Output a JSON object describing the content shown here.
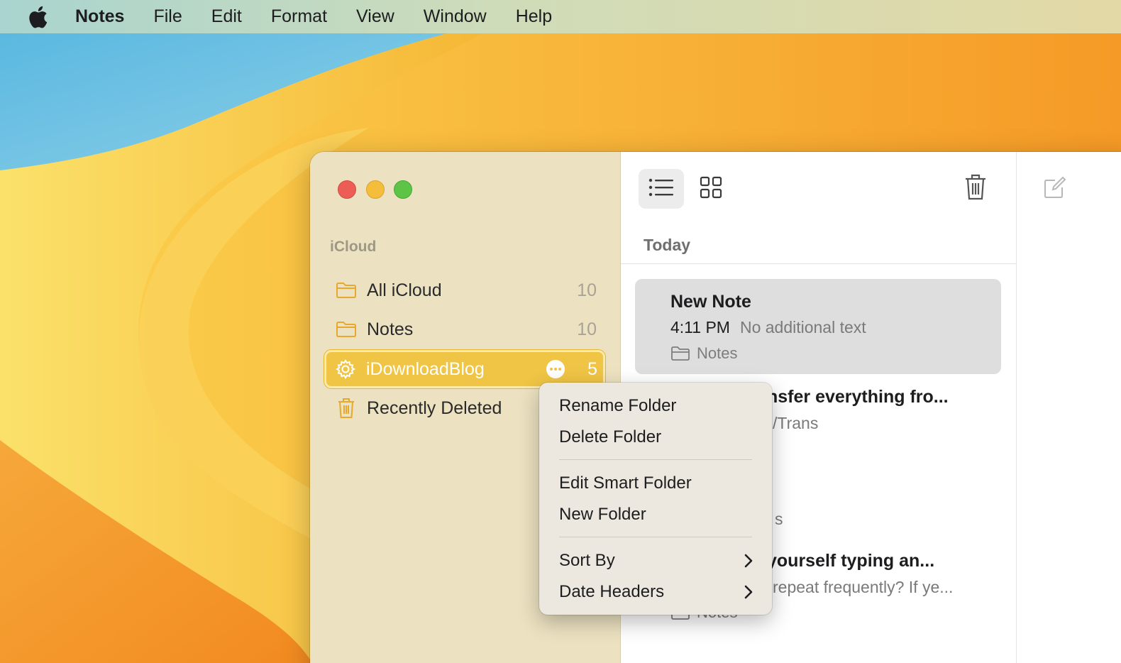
{
  "menubar": {
    "app_name": "Notes",
    "items": [
      "File",
      "Edit",
      "Format",
      "View",
      "Window",
      "Help"
    ]
  },
  "sidebar": {
    "section_header": "iCloud",
    "folders": [
      {
        "label": "All iCloud",
        "count": "10",
        "icon": "folder-icon"
      },
      {
        "label": "Notes",
        "count": "10",
        "icon": "folder-icon"
      },
      {
        "label": "iDownloadBlog",
        "count": "5",
        "icon": "gear-icon",
        "selected": true
      },
      {
        "label": "Recently Deleted",
        "count": "",
        "icon": "trash-icon"
      }
    ]
  },
  "note_list": {
    "group_header": "Today",
    "notes": [
      {
        "title": "New Note",
        "time": "4:11 PM",
        "preview": "No additional text",
        "folder": "Notes"
      },
      {
        "title": "nsfer everything fro...",
        "preview": "/Trans"
      },
      {
        "title": "s"
      },
      {
        "title": " yourself typing an...",
        "preview": "repeat frequently? If ye...",
        "folder": "Notes"
      }
    ]
  },
  "context_menu": {
    "items": [
      {
        "label": "Rename Folder"
      },
      {
        "label": "Delete Folder"
      },
      {
        "label": "Edit Smart Folder"
      },
      {
        "label": "New Folder"
      },
      {
        "label": "Sort By",
        "submenu": true
      },
      {
        "label": "Date Headers",
        "submenu": true
      }
    ]
  },
  "colors": {
    "accent": "#f0c545",
    "sidebar_bg": "#ece2c1",
    "traffic_close": "#ec5e55",
    "traffic_minimize": "#f4bd3b",
    "traffic_maximize": "#5ec448"
  }
}
